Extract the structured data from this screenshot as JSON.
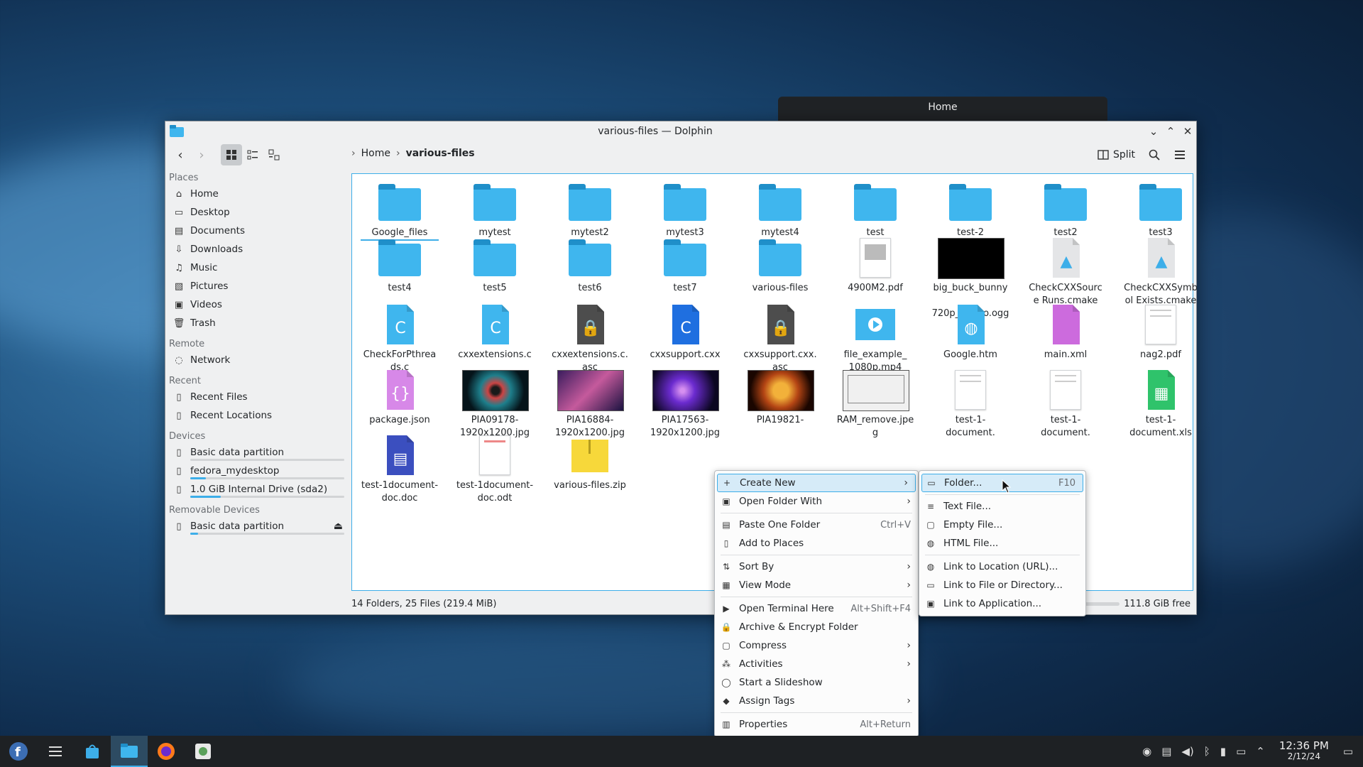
{
  "ghost_window": {
    "title": "Home"
  },
  "window": {
    "title": "various-files — Dolphin"
  },
  "toolbar": {
    "split_label": "Split"
  },
  "breadcrumb": [
    "Home",
    "various-files"
  ],
  "sidebar": {
    "places_label": "Places",
    "places": [
      {
        "label": "Home",
        "icon": "home-icon"
      },
      {
        "label": "Desktop",
        "icon": "desktop-icon"
      },
      {
        "label": "Documents",
        "icon": "documents-icon"
      },
      {
        "label": "Downloads",
        "icon": "downloads-icon"
      },
      {
        "label": "Music",
        "icon": "music-icon"
      },
      {
        "label": "Pictures",
        "icon": "pictures-icon"
      },
      {
        "label": "Videos",
        "icon": "videos-icon"
      },
      {
        "label": "Trash",
        "icon": "trash-icon"
      }
    ],
    "remote_label": "Remote",
    "remote": [
      {
        "label": "Network",
        "icon": "network-icon"
      }
    ],
    "recent_label": "Recent",
    "recent": [
      {
        "label": "Recent Files"
      },
      {
        "label": "Recent Locations"
      }
    ],
    "devices_label": "Devices",
    "devices": [
      {
        "label": "Basic data partition",
        "usage": 0
      },
      {
        "label": "fedora_mydesktop",
        "usage": 0.1
      },
      {
        "label": "1.0 GiB Internal Drive (sda2)",
        "usage": 0.2
      }
    ],
    "removable_label": "Removable Devices",
    "removable": [
      {
        "label": "Basic data partition",
        "usage": 0.05
      }
    ]
  },
  "files": [
    {
      "name": "Google_files",
      "type": "folder"
    },
    {
      "name": "mytest",
      "type": "folder"
    },
    {
      "name": "mytest2",
      "type": "folder"
    },
    {
      "name": "mytest3",
      "type": "folder"
    },
    {
      "name": "mytest4",
      "type": "folder"
    },
    {
      "name": "test",
      "type": "folder"
    },
    {
      "name": "test-2",
      "type": "folder"
    },
    {
      "name": "test2",
      "type": "folder"
    },
    {
      "name": "test3",
      "type": "folder"
    },
    {
      "name": "test4",
      "type": "folder"
    },
    {
      "name": "test5",
      "type": "folder"
    },
    {
      "name": "test6",
      "type": "folder"
    },
    {
      "name": "test7",
      "type": "folder"
    },
    {
      "name": "various-files",
      "type": "folder"
    },
    {
      "name": "4900M2.pdf",
      "type": "pdf"
    },
    {
      "name": "big_buck_bunny_ 720p_stereo.ogg",
      "type": "video"
    },
    {
      "name": "CheckCXXSource Runs.cmake",
      "type": "cmake"
    },
    {
      "name": "CheckCXXSymbol Exists.cmake",
      "type": "cmake"
    },
    {
      "name": "CheckForPthreads.c",
      "type": "c"
    },
    {
      "name": "cxxextensions.c",
      "type": "c"
    },
    {
      "name": "cxxextensions.c.asc",
      "type": "asc"
    },
    {
      "name": "cxxsupport.cxx",
      "type": "cxx"
    },
    {
      "name": "cxxsupport.cxx.asc",
      "type": "asc"
    },
    {
      "name": "file_example_ 1080p.mp4",
      "type": "mp4"
    },
    {
      "name": "Google.htm",
      "type": "htm"
    },
    {
      "name": "main.xml",
      "type": "xml"
    },
    {
      "name": "nag2.pdf",
      "type": "pdf2"
    },
    {
      "name": "package.json",
      "type": "json"
    },
    {
      "name": "PIA09178- 1920x1200.jpg",
      "type": "img1"
    },
    {
      "name": "PIA16884- 1920x1200.jpg",
      "type": "img2"
    },
    {
      "name": "PIA17563- 1920x1200.jpg",
      "type": "img3"
    },
    {
      "name": "PIA19821-",
      "type": "img4"
    },
    {
      "name": "RAM_remove.jpeg",
      "type": "img5"
    },
    {
      "name": "test-1-document.",
      "type": "pdf2"
    },
    {
      "name": "test-1-document.",
      "type": "pdf2"
    },
    {
      "name": "test-1-document.xls",
      "type": "xls"
    },
    {
      "name": "test-1document- doc.doc",
      "type": "doc"
    },
    {
      "name": "test-1document- doc.odt",
      "type": "odt"
    },
    {
      "name": "various-files.zip",
      "type": "zip"
    }
  ],
  "status": {
    "summary": "14 Folders, 25 Files (219.4 MiB)",
    "free": "111.8 GiB free"
  },
  "context_menu": [
    {
      "label": "Create New",
      "icon": "plus-icon",
      "submenu": true,
      "highlight": true
    },
    {
      "label": "Open Folder With",
      "icon": "open-with-icon",
      "submenu": true
    },
    {
      "sep": true
    },
    {
      "label": "Paste One Folder",
      "icon": "paste-icon",
      "shortcut": "Ctrl+V"
    },
    {
      "label": "Add to Places",
      "icon": "bookmark-icon"
    },
    {
      "sep": true
    },
    {
      "label": "Sort By",
      "icon": "sort-icon",
      "submenu": true
    },
    {
      "label": "View Mode",
      "icon": "view-mode-icon",
      "submenu": true
    },
    {
      "sep": true
    },
    {
      "label": "Open Terminal Here",
      "icon": "terminal-icon",
      "shortcut": "Alt+Shift+F4"
    },
    {
      "label": "Archive & Encrypt Folder",
      "icon": "lock-icon"
    },
    {
      "label": "Compress",
      "icon": "compress-icon",
      "submenu": true
    },
    {
      "label": "Activities",
      "icon": "activities-icon",
      "submenu": true
    },
    {
      "label": "Start a Slideshow",
      "icon": "slideshow-icon"
    },
    {
      "label": "Assign Tags",
      "icon": "tag-icon",
      "submenu": true
    },
    {
      "sep": true
    },
    {
      "label": "Properties",
      "icon": "properties-icon",
      "shortcut": "Alt+Return"
    }
  ],
  "submenu": [
    {
      "label": "Folder...",
      "icon": "folder-icon",
      "shortcut": "F10",
      "highlight": true
    },
    {
      "sep": true
    },
    {
      "label": "Text File...",
      "icon": "text-file-icon"
    },
    {
      "label": "Empty File...",
      "icon": "empty-file-icon"
    },
    {
      "label": "HTML File...",
      "icon": "html-file-icon"
    },
    {
      "sep": true
    },
    {
      "label": "Link to Location (URL)...",
      "icon": "link-url-icon"
    },
    {
      "label": "Link to File or Directory...",
      "icon": "link-file-icon"
    },
    {
      "label": "Link to Application...",
      "icon": "link-app-icon"
    }
  ],
  "clock": {
    "time": "12:36 PM",
    "date": "2/12/24"
  },
  "colors": {
    "accent": "#3daee9",
    "folder": "#3fb6ee",
    "selection": "#d6ebf8"
  }
}
